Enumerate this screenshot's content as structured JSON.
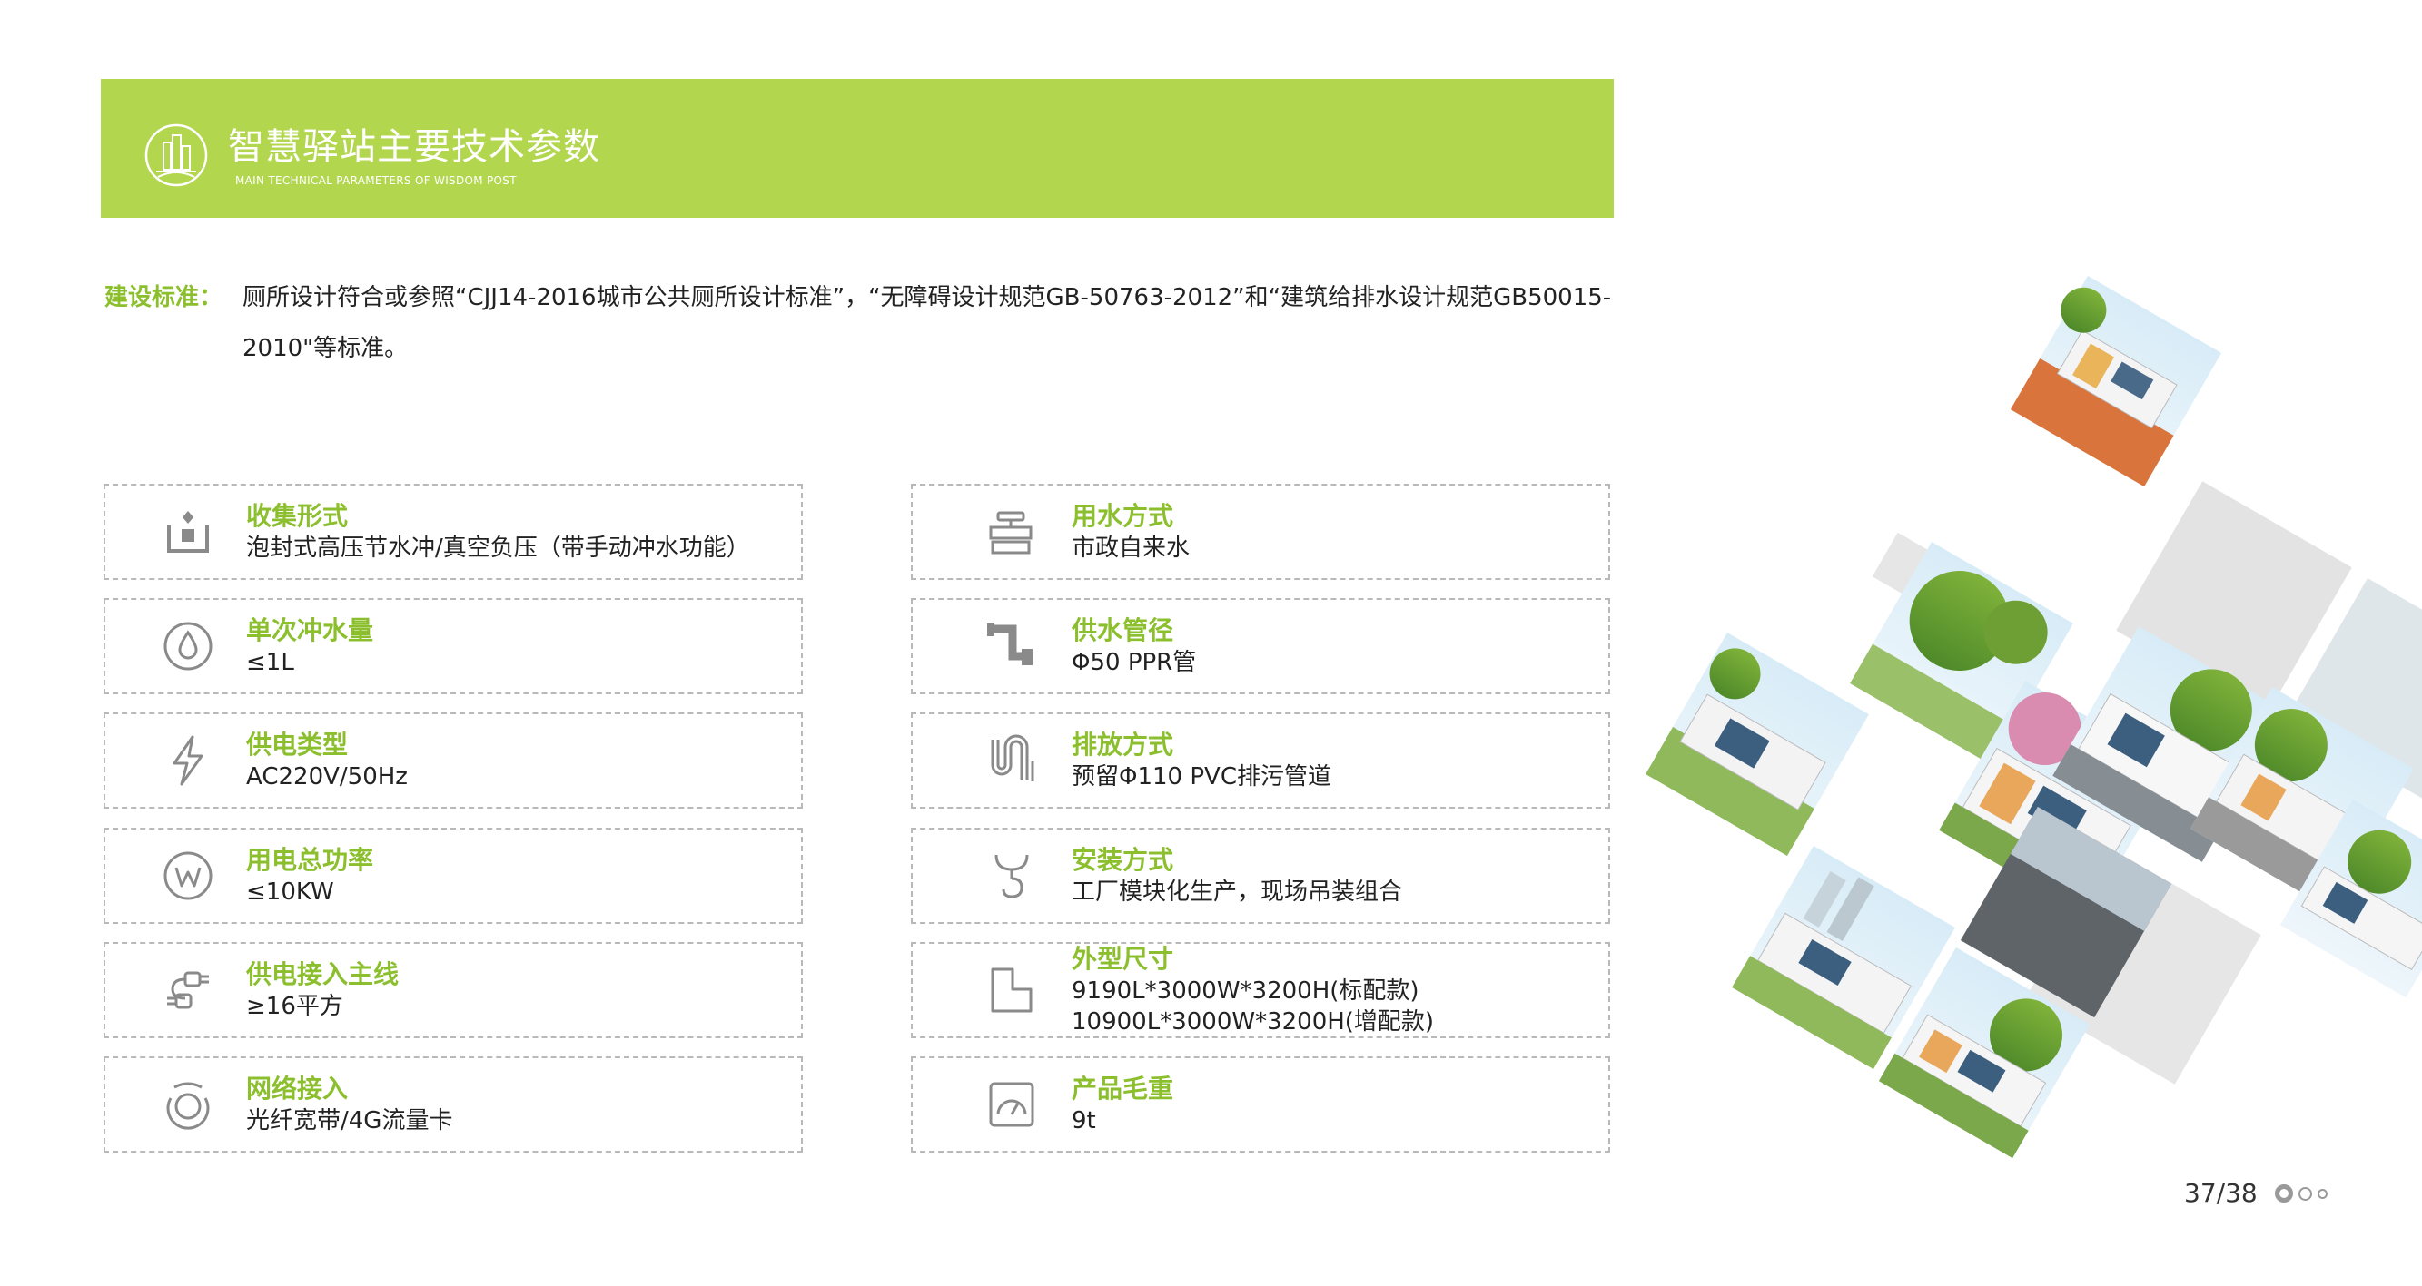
{
  "header": {
    "title": "智慧驿站主要技术参数",
    "subtitle": "MAIN TECHNICAL PARAMETERS OF WISDOM POST"
  },
  "standard": {
    "label": "建设标准：",
    "text": "厕所设计符合或参照“CJJ14-2016城市公共厕所设计标准”，“无障碍设计规范GB-50763-2012”和“建筑给排水设计规范GB50015-2010\"等标准。"
  },
  "left_params": [
    {
      "title": "收集形式",
      "value": "泡封式高压节水冲/真空负压（带手动冲水功能）",
      "icon": "collection-icon"
    },
    {
      "title": "单次冲水量",
      "value": "≤1L",
      "icon": "water-drop-icon"
    },
    {
      "title": "供电类型",
      "value": "AC220V/50Hz",
      "icon": "lightning-icon"
    },
    {
      "title": "用电总功率",
      "value": "≤10KW",
      "icon": "watt-icon"
    },
    {
      "title": "供电接入主线",
      "value": "≥16平方",
      "icon": "plug-icon"
    },
    {
      "title": "网络接入",
      "value": "光纤宽带/4G流量卡",
      "icon": "network-icon"
    }
  ],
  "right_params": [
    {
      "title": "用水方式",
      "value": "市政自来水",
      "icon": "faucet-icon"
    },
    {
      "title": "供水管径",
      "value": "Φ50 PPR管",
      "icon": "pipe-icon"
    },
    {
      "title": "排放方式",
      "value": "预留Φ110 PVC排污管道",
      "icon": "drain-icon"
    },
    {
      "title": "安装方式",
      "value": "工厂模块化生产，现场吊装组合",
      "icon": "crane-hook-icon"
    },
    {
      "title": "外型尺寸",
      "value": "9190L*3000W*3200H(标配款)",
      "value2": "10900L*3000W*3200H(增配款)",
      "icon": "dimension-icon"
    },
    {
      "title": "产品毛重",
      "value": "9t",
      "icon": "weight-scale-icon"
    }
  ],
  "pager": {
    "label": "37/38"
  },
  "colors": {
    "accent": "#b3d64f",
    "title_green": "#8cbf2e",
    "border": "#b9b9b9",
    "icon_gray": "#8a8a8a"
  }
}
